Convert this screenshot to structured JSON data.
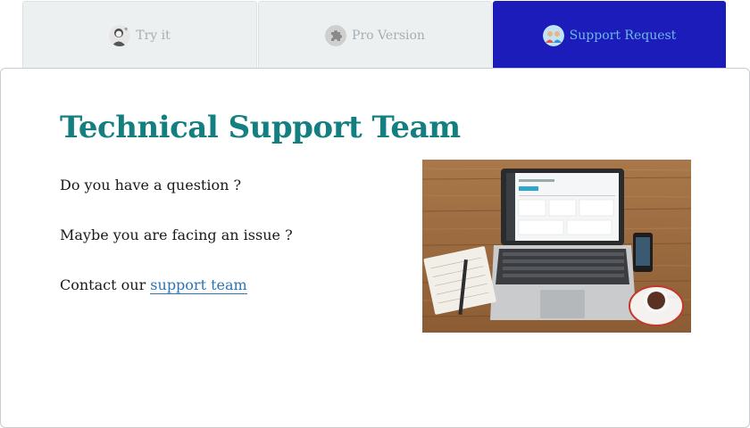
{
  "tabs": [
    {
      "label": "Try it",
      "icon": "person-icon",
      "active": false
    },
    {
      "label": "Pro Version",
      "icon": "puzzle-icon",
      "active": false
    },
    {
      "label": "Support Request",
      "icon": "support-people-icon",
      "active": true
    }
  ],
  "colors": {
    "active_tab_bg": "#1c1cbb",
    "active_tab_text": "#6fb8e6",
    "title": "#137f80",
    "link": "#2a74b6"
  },
  "panel": {
    "title": "Technical Support Team",
    "line1": "Do you have a question ?",
    "line2": "Maybe you are facing an issue ?",
    "line3_prefix": "Contact our ",
    "line3_link": "support team",
    "image": "laptop-desk-photo"
  }
}
